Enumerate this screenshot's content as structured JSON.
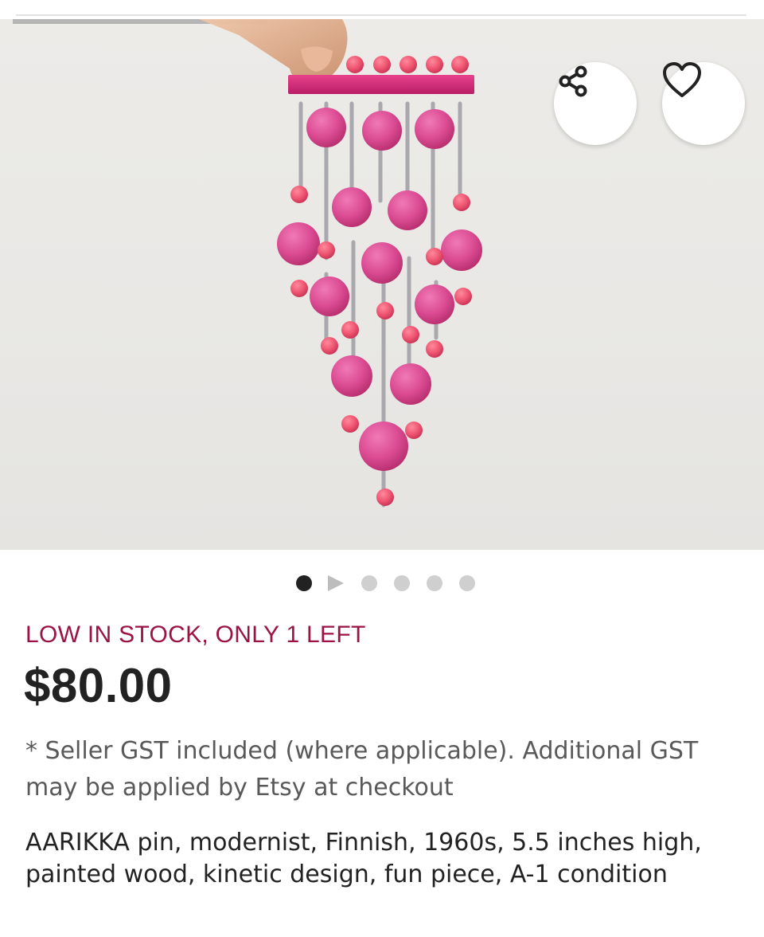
{
  "listing": {
    "image_alt": "Pink wooden bead kinetic pin held against a light background",
    "carousel": {
      "total": 6,
      "active_index": 0,
      "video_index": 1
    },
    "actions": {
      "share_icon": "share-icon",
      "favorite_icon": "heart-outline-icon"
    },
    "stock_status": "LOW IN STOCK, ONLY 1 LEFT",
    "price": "$80.00",
    "tax_note": "* Seller GST included (where applicable). Additional GST may be applied by Etsy at checkout",
    "title": "AARIKKA pin, modernist, Finnish, 1960s, 5.5 inches high, painted wood, kinetic design, fun piece, A-1 condition"
  },
  "colors": {
    "stock_accent": "#9b1243",
    "bead_pink": "#e04d96",
    "price_text": "#222222"
  }
}
